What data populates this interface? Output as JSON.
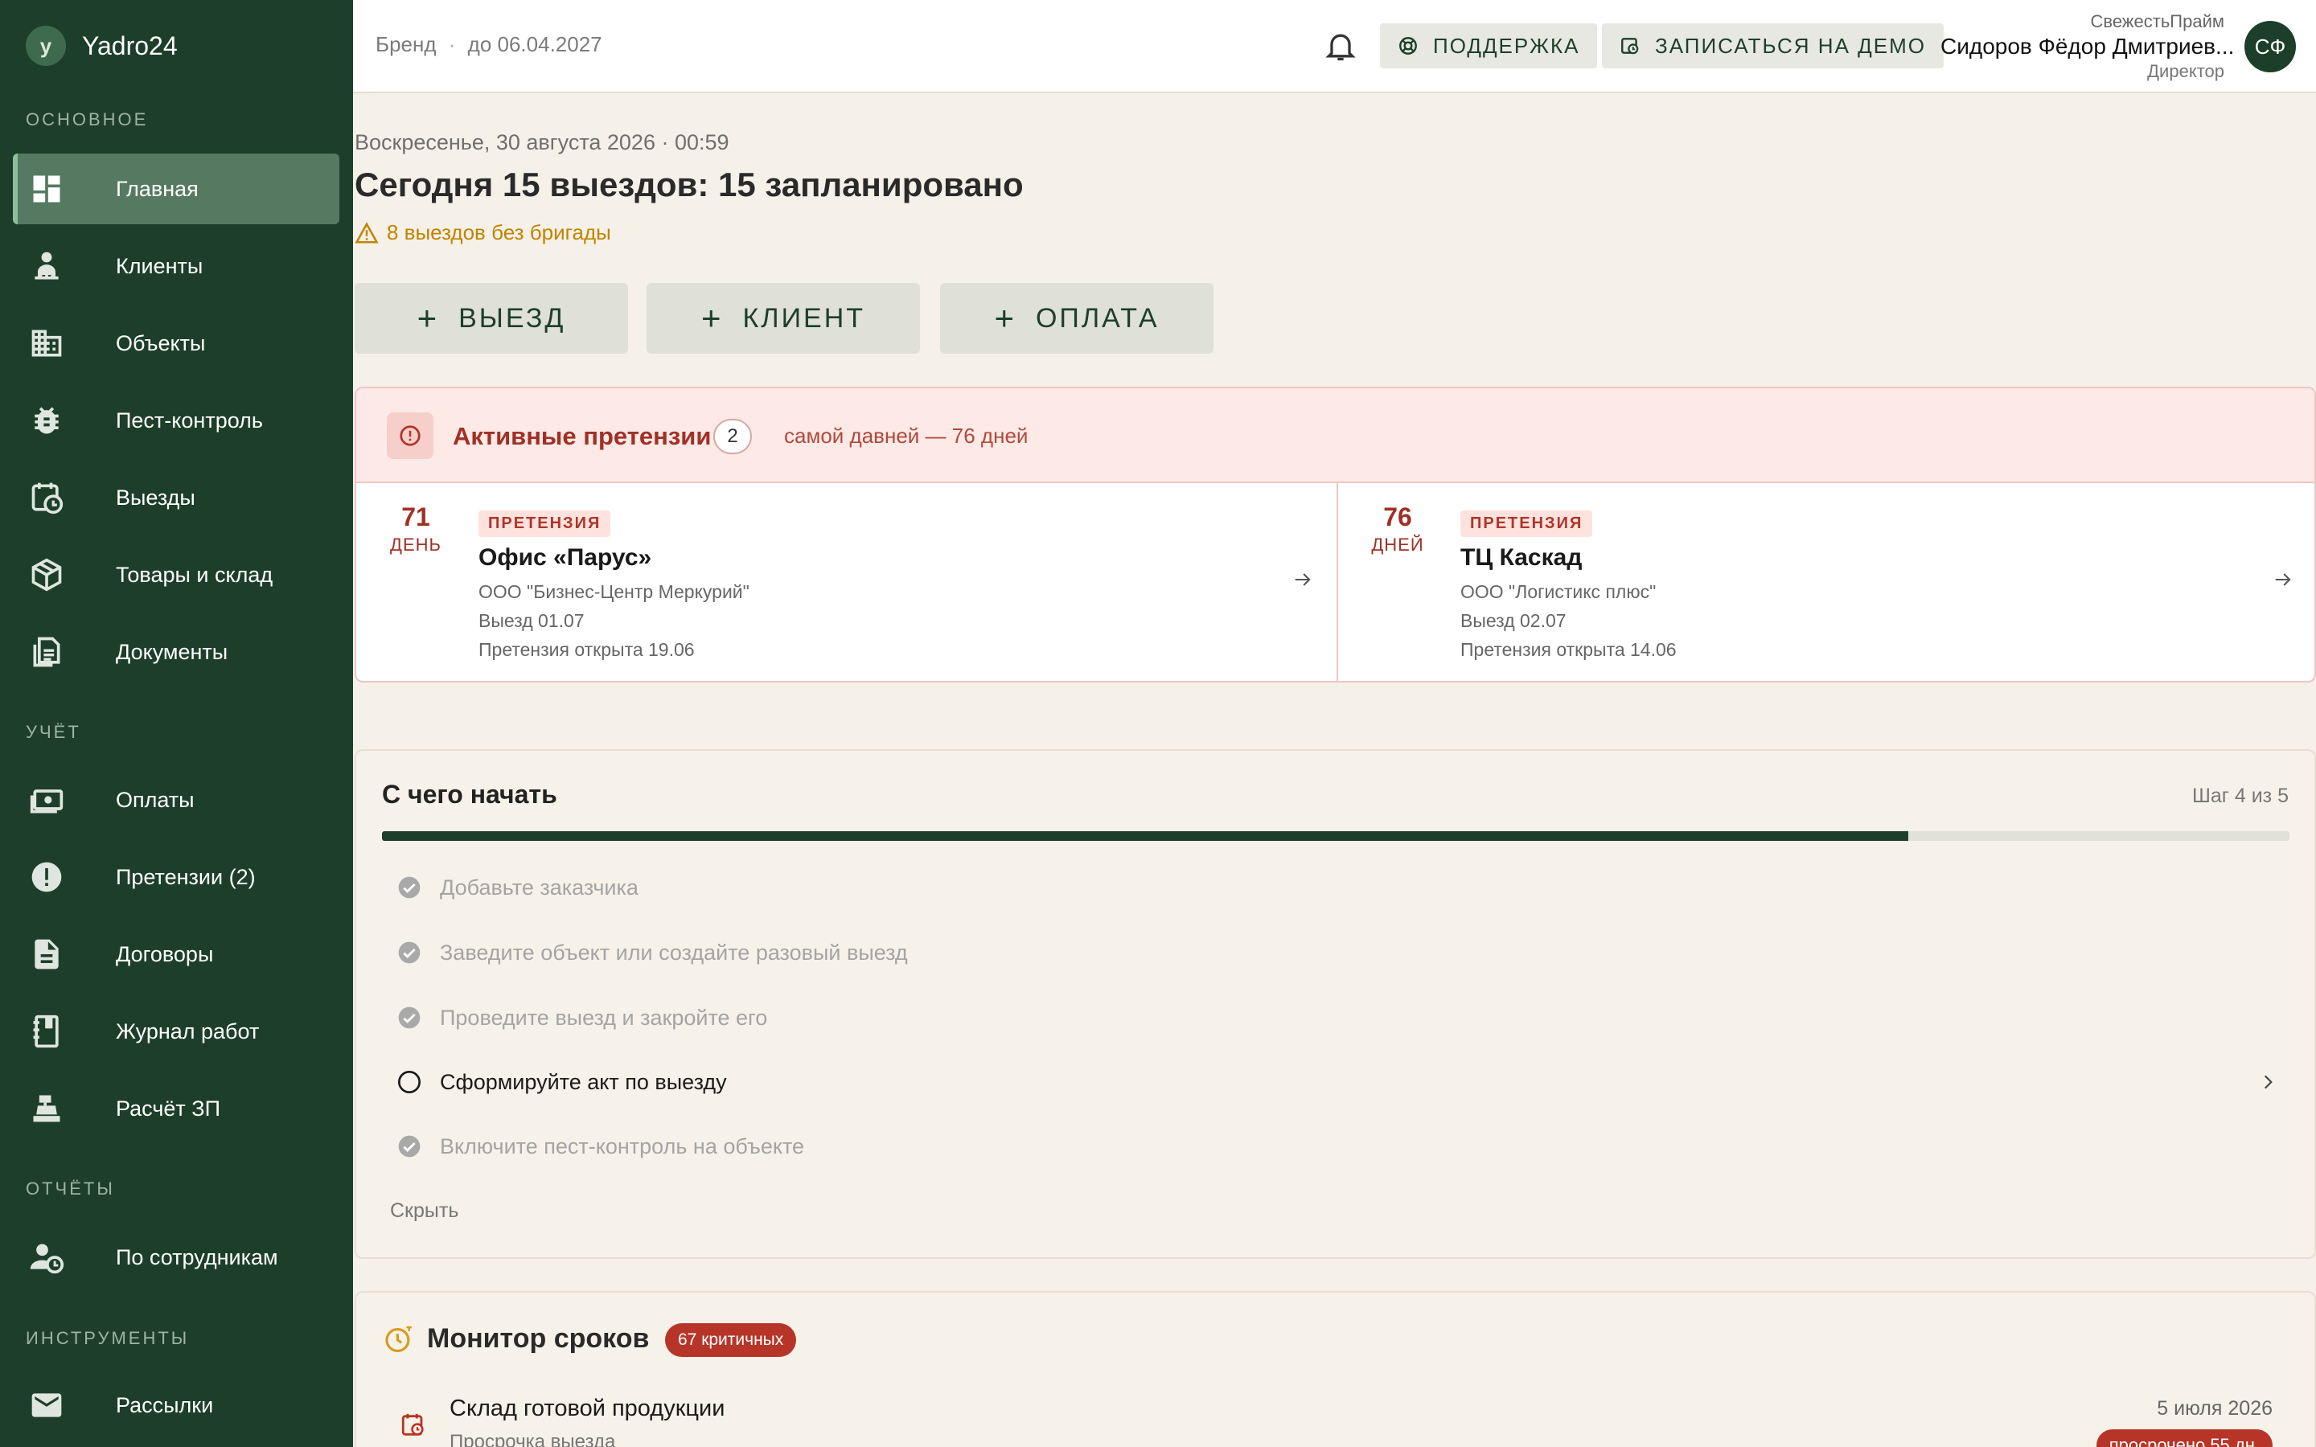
{
  "brand": {
    "badge": "y",
    "name": "Yadro24"
  },
  "sidebar": {
    "sections": {
      "main": "ОСНОВНОЕ",
      "accounting": "УЧЁТ",
      "reports": "ОТЧЁТЫ",
      "tools": "ИНСТРУМЕНТЫ"
    },
    "items": [
      {
        "label": "Главная",
        "icon": "dashboard-icon",
        "active": true
      },
      {
        "label": "Клиенты",
        "icon": "clients-icon"
      },
      {
        "label": "Объекты",
        "icon": "building-icon"
      },
      {
        "label": "Пест-контроль",
        "icon": "bug-icon"
      },
      {
        "label": "Выезды",
        "icon": "calendar-clock-icon"
      },
      {
        "label": "Товары и склад",
        "icon": "box-icon"
      },
      {
        "label": "Документы",
        "icon": "documents-icon"
      },
      {
        "label": "Оплаты",
        "icon": "money-icon"
      },
      {
        "label": "Претензии (2)",
        "icon": "alert-circle-icon"
      },
      {
        "label": "Договоры",
        "icon": "contract-icon"
      },
      {
        "label": "Журнал работ",
        "icon": "journal-icon"
      },
      {
        "label": "Расчёт ЗП",
        "icon": "cash-register-icon"
      },
      {
        "label": "По сотрудникам",
        "icon": "employee-clock-icon"
      },
      {
        "label": "Рассылки",
        "icon": "mail-icon"
      }
    ]
  },
  "header": {
    "plan": "Бренд",
    "separator": "·",
    "expires": "до 06.04.2027",
    "support_label": "ПОДДЕРЖКА",
    "demo_label": "ЗАПИСАТЬСЯ НА ДЕМО",
    "user": {
      "org": "СвежестьПрайм",
      "name": "Сидоров Фёдор Дмитриев...",
      "role": "Директор",
      "initials": "СФ"
    }
  },
  "main": {
    "date": "Воскресенье, 30 августа 2026 · 00:59",
    "headline": "Сегодня 15 выездов: 15 запланировано",
    "warning": "8 выездов без бригады",
    "quick_actions": [
      {
        "label": "ВЫЕЗД"
      },
      {
        "label": "КЛИЕНТ"
      },
      {
        "label": "ОПЛАТА"
      }
    ]
  },
  "claims": {
    "title": "Активные претензии",
    "count": "2",
    "subtitle": "самой давней — 76 дней",
    "items": [
      {
        "days": "71",
        "unit": "ДЕНЬ",
        "tag": "ПРЕТЕНЗИЯ",
        "title": "Офис «Парус»",
        "company": "ООО \"Бизнес-Центр Меркурий\"",
        "visit": "Выезд 01.07",
        "opened": "Претензия открыта 19.06"
      },
      {
        "days": "76",
        "unit": "ДНЕЙ",
        "tag": "ПРЕТЕНЗИЯ",
        "title": "ТЦ Каскад",
        "company": "ООО \"Логистикс плюс\"",
        "visit": "Выезд 02.07",
        "opened": "Претензия открыта 14.06"
      }
    ]
  },
  "getting_started": {
    "title": "С чего начать",
    "step": "Шаг 4 из 5",
    "progress": 0.8,
    "items": [
      {
        "label": "Добавьте заказчика",
        "done": true
      },
      {
        "label": "Заведите объект или создайте разовый выезд",
        "done": true
      },
      {
        "label": "Проведите выезд и закройте его",
        "done": true
      },
      {
        "label": "Сформируйте акт по выезду",
        "done": false
      },
      {
        "label": "Включите пест-контроль на объекте",
        "done": true
      }
    ],
    "hide_label": "Скрыть"
  },
  "monitor": {
    "title": "Монитор сроков",
    "badge": "67 критичных",
    "row": {
      "title": "Склад готовой продукции",
      "subtitle": "Просрочка выезда",
      "date": "5 июля 2026",
      "badge": "просрочено 55 дн."
    }
  },
  "colors": {
    "sidebar": "#1d3f29",
    "active_nav": "#557a61",
    "accent_red": "#a03025",
    "warning": "#c18400",
    "background": "#f5f1e8"
  }
}
